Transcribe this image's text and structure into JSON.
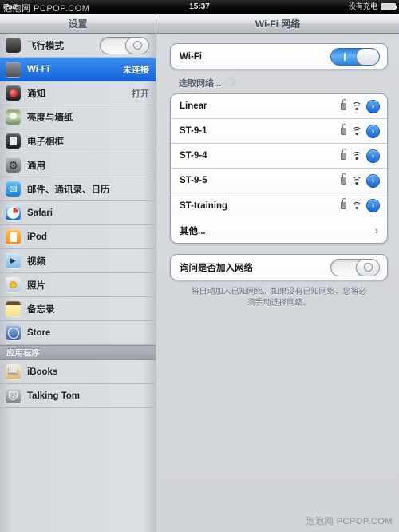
{
  "status_bar": {
    "device": "iPad",
    "time": "15:37",
    "battery_text": "没有充电"
  },
  "nav": {
    "left_title": "设置",
    "right_title": "Wi-Fi 网络"
  },
  "watermark": {
    "top": "泡泡网  PCPOP.COM",
    "bottom": "泡泡网  PCPOP.COM"
  },
  "sidebar": {
    "items": [
      {
        "label": "飞行模式",
        "icon": "airplane-icon",
        "icon_class": "ic-airplane",
        "control": "toggle",
        "toggle_on": false
      },
      {
        "label": "Wi-Fi",
        "icon": "wifi-icon",
        "icon_class": "ic-wifi",
        "value": "未连接",
        "selected": true
      },
      {
        "label": "通知",
        "icon": "notifications-icon",
        "icon_class": "ic-notif",
        "value": "打开"
      },
      {
        "label": "亮度与墙纸",
        "icon": "brightness-wallpaper-icon",
        "icon_class": "ic-bright"
      },
      {
        "label": "电子相框",
        "icon": "picture-frame-icon",
        "icon_class": "ic-frame"
      },
      {
        "label": "通用",
        "icon": "general-gear-icon",
        "icon_class": "ic-general"
      },
      {
        "label": "邮件、通讯录、日历",
        "icon": "mail-icon",
        "icon_class": "ic-mail"
      },
      {
        "label": "Safari",
        "icon": "safari-icon",
        "icon_class": "ic-safari"
      },
      {
        "label": "iPod",
        "icon": "ipod-icon",
        "icon_class": "ic-ipod"
      },
      {
        "label": "视频",
        "icon": "video-icon",
        "icon_class": "ic-video"
      },
      {
        "label": "照片",
        "icon": "photos-icon",
        "icon_class": "ic-photos"
      },
      {
        "label": "备忘录",
        "icon": "notes-icon",
        "icon_class": "ic-notes"
      },
      {
        "label": "Store",
        "icon": "store-icon",
        "icon_class": "ic-store"
      }
    ],
    "apps_header": "应用程序",
    "apps": [
      {
        "label": "iBooks",
        "icon": "ibooks-icon",
        "icon_class": "ic-ibooks"
      },
      {
        "label": "Talking Tom",
        "icon": "talking-tom-icon",
        "icon_class": "ic-tom"
      }
    ]
  },
  "panel": {
    "wifi_row": {
      "label": "Wi-Fi",
      "toggle_on": true
    },
    "choose_network_title": "选取网络...",
    "networks": [
      {
        "name": "Linear",
        "secured": true,
        "signal": 3,
        "detail": true
      },
      {
        "name": "ST-9-1",
        "secured": true,
        "signal": 3,
        "detail": true
      },
      {
        "name": "ST-9-4",
        "secured": true,
        "signal": 3,
        "detail": true
      },
      {
        "name": "ST-9-5",
        "secured": true,
        "signal": 3,
        "detail": true
      },
      {
        "name": "ST-training",
        "secured": true,
        "signal": 3,
        "detail": true
      }
    ],
    "other_row": {
      "label": "其他..."
    },
    "ask_row": {
      "label": "询问是否加入网络",
      "toggle_on": false
    },
    "footnote": "将自动加入已知网络。如果没有已知网络，您将必须手动选择网络。"
  },
  "colors": {
    "selection_blue": "#1464d8",
    "toggle_on_blue": "#2f88e8",
    "panel_bg": "#d3d6da",
    "chevron_blue": "#1769d6"
  }
}
